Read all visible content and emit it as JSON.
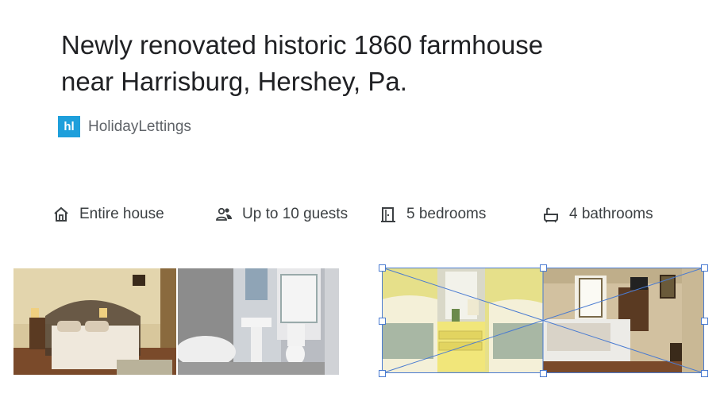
{
  "listing": {
    "title_line1": "Newly renovated historic 1860 farmhouse",
    "title_line2": "near Harrisburg, Hershey, Pa."
  },
  "provider": {
    "logo_text": "hl",
    "name": "HolidayLettings",
    "logo_color": "#1e9fdb"
  },
  "features": [
    {
      "icon": "house-icon",
      "label": "Entire house"
    },
    {
      "icon": "guests-icon",
      "label": "Up to 10 guests"
    },
    {
      "icon": "door-icon",
      "label": "5 bedrooms"
    },
    {
      "icon": "bathtub-icon",
      "label": "4 bathrooms"
    }
  ],
  "photos": [
    {
      "subject": "bedroom with iron bed"
    },
    {
      "subject": "bathroom with corner tub"
    },
    {
      "subject": "yellow twin bedroom",
      "selected": true
    },
    {
      "subject": "bedroom with window"
    }
  ],
  "colors": {
    "text": "#202124",
    "secondary_text": "#5f6368",
    "selection": "#4a7bd1"
  }
}
